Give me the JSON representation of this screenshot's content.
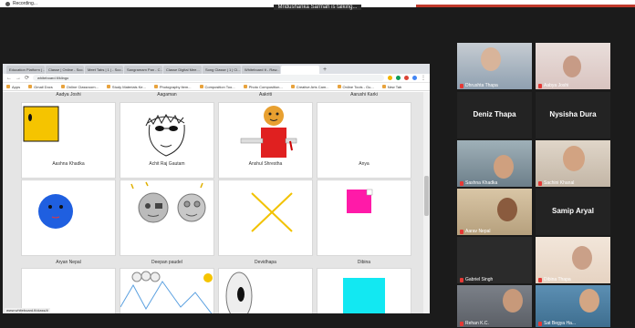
{
  "meeting": {
    "recording_label": "Recording...",
    "talking_banner": "Mridushanka Sarmah is talking..."
  },
  "browser": {
    "tabs": [
      "Education Platform | ...",
      "Classe | Online - Sco...",
      "Meet Tabs | 1 | - Sco...",
      "Sangramam Pan - C...",
      "Classe Digital Mee...",
      "Song Classe | 1 | Cl...",
      "Whiteboard It - Raw..."
    ],
    "url": "whiteboard.fi/klingo",
    "bookmarks": [
      "Apps",
      "Gmail Docs",
      "Online Classroom...",
      "Study Materials Ke...",
      "Photography ltem...",
      "Composition Too...",
      "Photo Composition...",
      "Creative Arts Cam...",
      "Online Tools - Gu...",
      "New Tab"
    ],
    "status_url": "www.whiteboard.fi/class/#"
  },
  "whiteboard": {
    "top_names": [
      "Aadya Joshi",
      "Aagaman",
      "Aakriti",
      "Aarushi Karki"
    ],
    "rows": [
      [
        "Aashna Khadka",
        "Achit Raj Gautam",
        "Anshul Shrestha",
        "Anya"
      ],
      [
        "Aryan Nepal",
        "Deepan paudel",
        "Devidhapa",
        "Dibina"
      ]
    ]
  },
  "participants": [
    {
      "name": "Dhrushta Thapa",
      "video": true,
      "color": "#8fa0b0"
    },
    {
      "name": "Aabya Joshi",
      "video": true,
      "color": "#d9c4c0"
    },
    {
      "name": "Deniz Thapa",
      "video": false
    },
    {
      "name": "Nysisha Dura",
      "video": false
    },
    {
      "name": "Sashna Khadka",
      "video": true,
      "color": "#6d7f8a"
    },
    {
      "name": "Sachini Khanal",
      "video": true,
      "color": "#c3b6a6"
    },
    {
      "name": "Aarav Nepal",
      "video": true,
      "color": "#b6a07d"
    },
    {
      "name": "Samip Aryal",
      "video": false
    },
    {
      "name": "Gabriel Singh",
      "video": true,
      "color": "#3b3b3b"
    },
    {
      "name": "Dibina Thapa",
      "video": true,
      "color": "#e6d3c2"
    },
    {
      "name": "Rehan K.C.",
      "video": true,
      "color": "#5b5f66"
    },
    {
      "name": "Sat Begya Ha...",
      "video": true,
      "color": "#3e6e8f"
    }
  ],
  "colors": {
    "mic_muted": "#e53935",
    "accent": "#ffffff"
  }
}
